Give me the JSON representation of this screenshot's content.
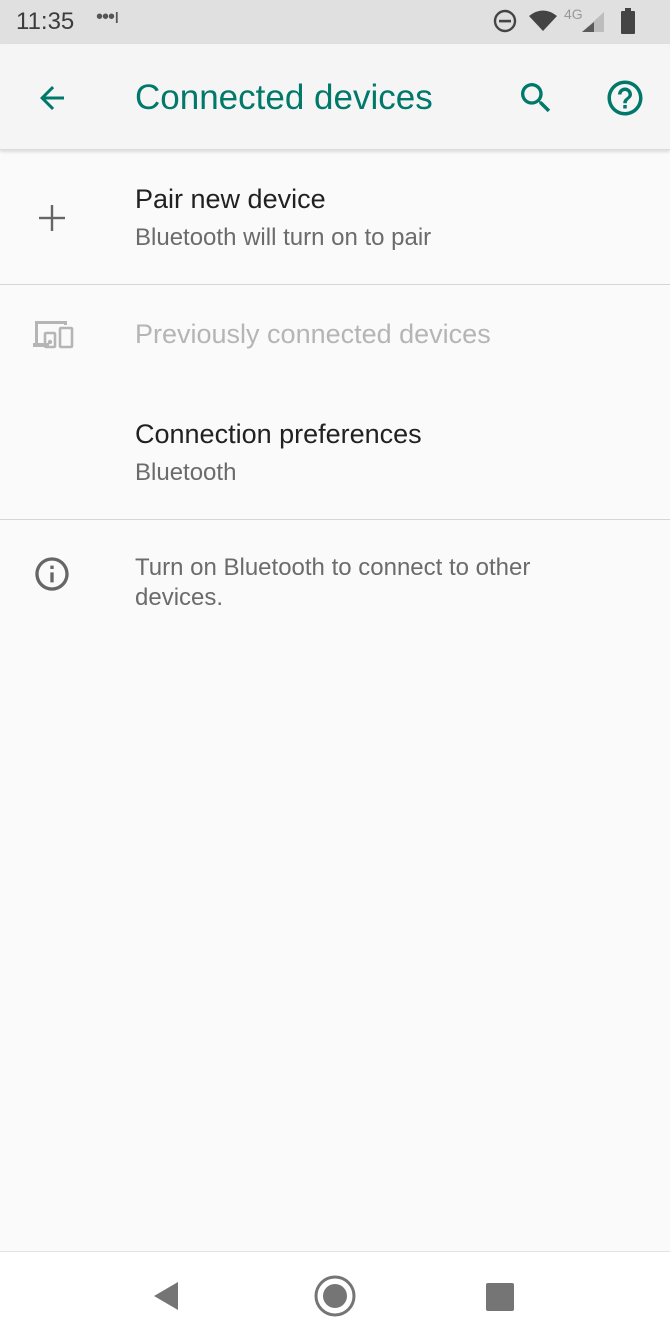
{
  "status_bar": {
    "time": "11:35",
    "notification_dots": "•••ı",
    "network_label": "4G",
    "icons": [
      "do-not-disturb-icon",
      "wifi-icon",
      "cellular-signal-icon",
      "battery-icon"
    ]
  },
  "app_bar": {
    "title": "Connected devices",
    "accent_color": "#00796b",
    "icons": [
      "back-arrow-icon",
      "search-icon",
      "help-icon"
    ]
  },
  "items": [
    {
      "icon": "plus-icon",
      "title": "Pair new device",
      "subtitle": "Bluetooth will turn on to pair"
    },
    {
      "icon": "devices-icon",
      "title": "Previously connected devices",
      "disabled": true
    },
    {
      "title": "Connection preferences",
      "subtitle": "Bluetooth"
    }
  ],
  "info": {
    "icon": "info-icon",
    "text": "Turn on Bluetooth to connect to other devices."
  },
  "nav_bar": {
    "icons": [
      "back-triangle-icon",
      "home-circle-icon",
      "recents-square-icon"
    ]
  }
}
